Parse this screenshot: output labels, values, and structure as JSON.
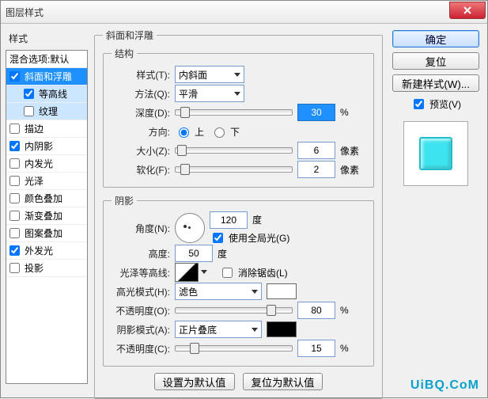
{
  "window": {
    "title": "图层样式"
  },
  "styles": {
    "header": "样式",
    "blend_defaults": "混合选项:默认",
    "items": [
      {
        "label": "斜面和浮雕",
        "checked": true,
        "selected": true,
        "sub": false
      },
      {
        "label": "等高线",
        "checked": true,
        "selected": false,
        "sub": true,
        "subsel": true
      },
      {
        "label": "纹理",
        "checked": false,
        "selected": false,
        "sub": true,
        "subsel": true
      },
      {
        "label": "描边",
        "checked": false,
        "selected": false,
        "sub": false
      },
      {
        "label": "内阴影",
        "checked": true,
        "selected": false,
        "sub": false
      },
      {
        "label": "内发光",
        "checked": false,
        "selected": false,
        "sub": false
      },
      {
        "label": "光泽",
        "checked": false,
        "selected": false,
        "sub": false
      },
      {
        "label": "颜色叠加",
        "checked": false,
        "selected": false,
        "sub": false
      },
      {
        "label": "渐变叠加",
        "checked": false,
        "selected": false,
        "sub": false
      },
      {
        "label": "图案叠加",
        "checked": false,
        "selected": false,
        "sub": false
      },
      {
        "label": "外发光",
        "checked": true,
        "selected": false,
        "sub": false
      },
      {
        "label": "投影",
        "checked": false,
        "selected": false,
        "sub": false
      }
    ]
  },
  "bevel": {
    "group": "斜面和浮雕",
    "structure_group": "结构",
    "style_label": "样式(T):",
    "style_value": "内斜面",
    "technique_label": "方法(Q):",
    "technique_value": "平滑",
    "depth_label": "深度(D):",
    "depth_value": "30",
    "depth_unit": "%",
    "direction_label": "方向:",
    "dir_up": "上",
    "dir_down": "下",
    "dir_selected": "up",
    "size_label": "大小(Z):",
    "size_value": "6",
    "size_unit": "像素",
    "soften_label": "软化(F):",
    "soften_value": "2",
    "soften_unit": "像素"
  },
  "shading": {
    "group": "阴影",
    "angle_label": "角度(N):",
    "angle_value": "120",
    "angle_unit": "度",
    "use_global_label": "使用全局光(G)",
    "use_global_checked": true,
    "altitude_label": "高度:",
    "altitude_value": "50",
    "altitude_unit": "度",
    "gloss_label": "光泽等高线:",
    "antialias_label": "消除锯齿(L)",
    "antialias_checked": false,
    "highlight_mode_label": "高光模式(H):",
    "highlight_mode_value": "滤色",
    "highlight_color": "#ffffff",
    "highlight_opacity_label": "不透明度(O):",
    "highlight_opacity_value": "80",
    "highlight_opacity_unit": "%",
    "shadow_mode_label": "阴影模式(A):",
    "shadow_mode_value": "正片叠底",
    "shadow_color": "#000000",
    "shadow_opacity_label": "不透明度(C):",
    "shadow_opacity_value": "15",
    "shadow_opacity_unit": "%"
  },
  "bottom": {
    "make_default": "设置为默认值",
    "reset_default": "复位为默认值"
  },
  "right": {
    "ok": "确定",
    "cancel": "复位",
    "new_style": "新建样式(W)...",
    "preview_label": "预览(V)",
    "preview_checked": true
  },
  "watermark": "UiBQ.CoM"
}
